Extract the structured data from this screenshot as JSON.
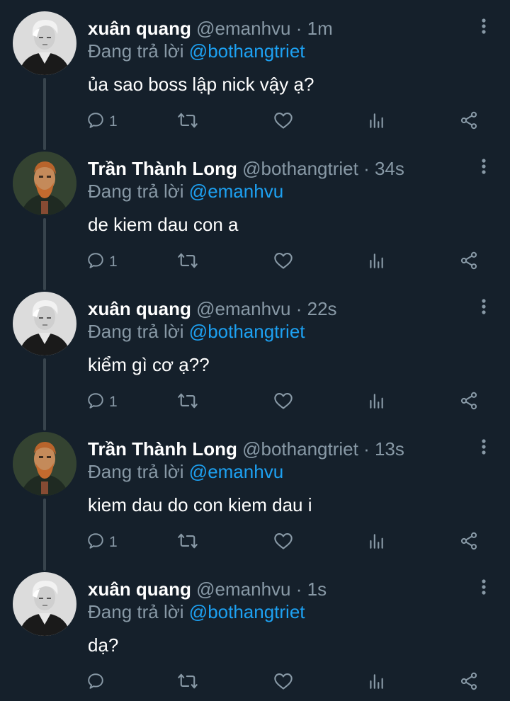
{
  "thread": {
    "tweets": [
      {
        "display_name": "xuân quang",
        "handle": "@emanhvu",
        "time": "1m",
        "replying_to_prefix": "Đang trả lời",
        "replying_to_handle": "@bothangtriet",
        "text": "ủa sao boss lập nick vậy ạ?",
        "reply_count": "1",
        "avatar": "bw-portrait-young-man"
      },
      {
        "display_name": "Trần Thành Long",
        "handle": "@bothangtriet",
        "time": "34s",
        "replying_to_prefix": "Đang trả lời",
        "replying_to_handle": "@emanhvu",
        "text": "de kiem dau con a",
        "reply_count": "1",
        "avatar": "painted-portrait-bearded-man"
      },
      {
        "display_name": "xuân quang",
        "handle": "@emanhvu",
        "time": "22s",
        "replying_to_prefix": "Đang trả lời",
        "replying_to_handle": "@bothangtriet",
        "text": "kiểm gì cơ ạ??",
        "reply_count": "1",
        "avatar": "bw-portrait-young-man"
      },
      {
        "display_name": "Trần Thành Long",
        "handle": "@bothangtriet",
        "time": "13s",
        "replying_to_prefix": "Đang trả lời",
        "replying_to_handle": "@emanhvu",
        "text": "kiem dau do con kiem dau i",
        "reply_count": "1",
        "avatar": "painted-portrait-bearded-man"
      },
      {
        "display_name": "xuân quang",
        "handle": "@emanhvu",
        "time": "1s",
        "replying_to_prefix": "Đang trả lời",
        "replying_to_handle": "@bothangtriet",
        "text": "dạ?",
        "reply_count": "",
        "avatar": "bw-portrait-young-man"
      }
    ]
  },
  "separator": "·",
  "icons": {
    "reply": "reply-icon",
    "retweet": "retweet-icon",
    "like": "heart-icon",
    "views": "views-icon",
    "share": "share-icon",
    "more": "more-vertical-icon"
  },
  "colors": {
    "background": "#15202b",
    "text": "#ffffff",
    "muted": "#8899a6",
    "link": "#1da1f2",
    "thread_line": "#38444d"
  }
}
